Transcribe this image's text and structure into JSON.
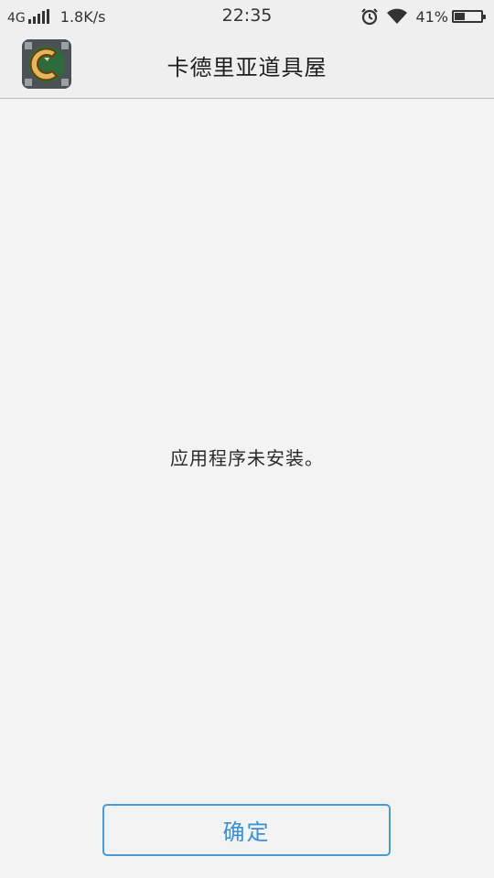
{
  "status_bar": {
    "network": "4G",
    "speed": "1.8K/s",
    "time": "22:35",
    "battery": "41%",
    "battery_level": 0.41,
    "icons": [
      "signal-icon",
      "alarm-icon",
      "wifi-icon",
      "battery-icon"
    ]
  },
  "header": {
    "title": "卡德里亚道具屋",
    "icon": "app-logo-icon"
  },
  "dialog": {
    "message": "应用程序未安装。",
    "confirm_label": "确定"
  },
  "colors": {
    "accent": "#3b8fd3",
    "background": "#f3f3f3",
    "header_background": "#efefef"
  }
}
